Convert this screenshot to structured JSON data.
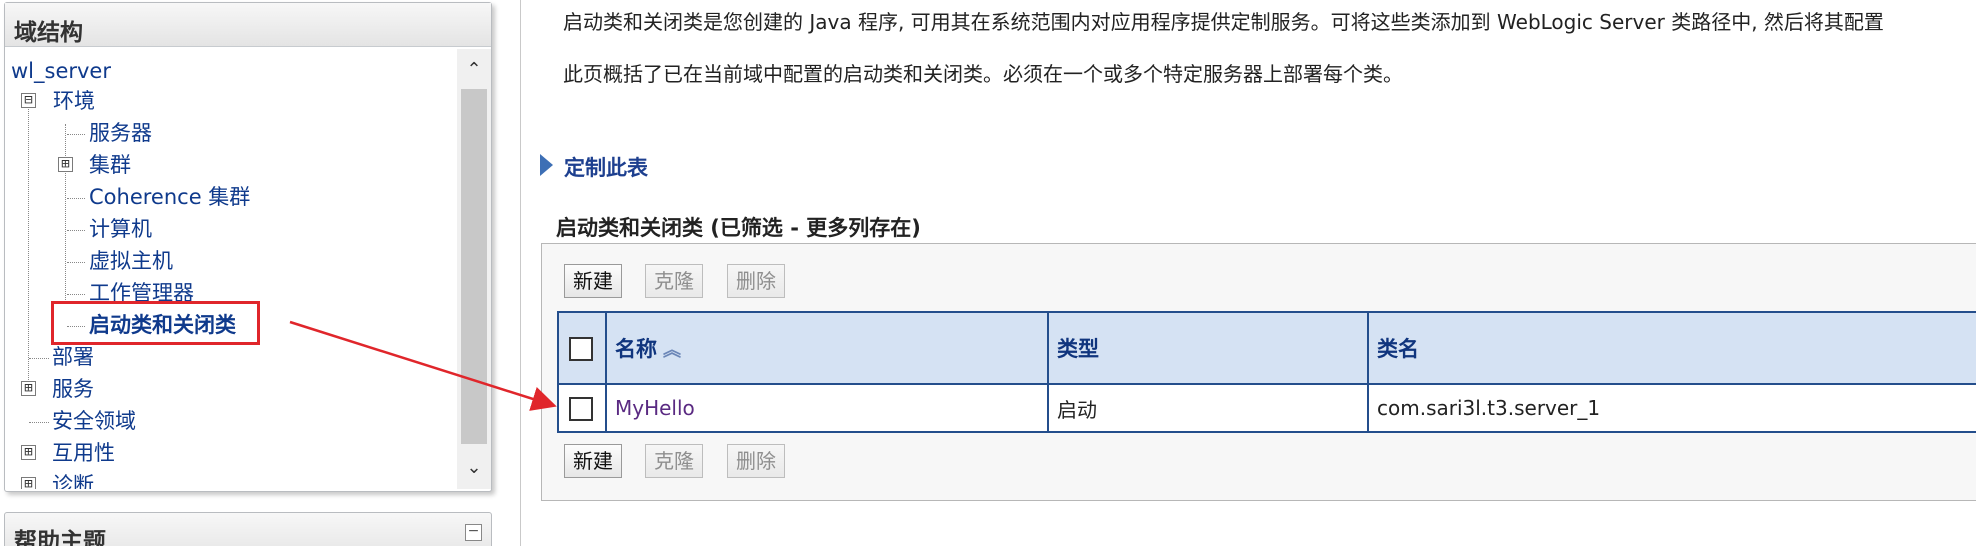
{
  "tree_panel": {
    "title": "域结构",
    "items": [
      {
        "label": "wl_server"
      },
      {
        "label": "环境",
        "expander": "⊟"
      },
      {
        "label": "服务器"
      },
      {
        "label": "集群",
        "expander": "⊞"
      },
      {
        "label": "Coherence 集群"
      },
      {
        "label": "计算机"
      },
      {
        "label": "虚拟主机"
      },
      {
        "label": "工作管理器"
      },
      {
        "label": "启动类和关闭类"
      },
      {
        "label": "部署"
      },
      {
        "label": "服务",
        "expander": "⊞"
      },
      {
        "label": "安全领域"
      },
      {
        "label": "互用性",
        "expander": "⊞"
      },
      {
        "label": "诊断",
        "expander": "⊞"
      }
    ]
  },
  "help_panel": {
    "title": "帮助主题",
    "collapse": "−"
  },
  "content": {
    "intro_line1": "启动类和关闭类是您创建的 Java 程序, 可用其在系统范围内对应用程序提供定制服务。可将这些类添加到 WebLogic Server 类路径中, 然后将其配置",
    "intro_line2": "此页概括了已在当前域中配置的启动类和关闭类。必须在一个或多个特定服务器上部署每个类。",
    "customize_label": "定制此表",
    "section_title": "启动类和关闭类 (已筛选 - 更多列存在)",
    "buttons": {
      "new": "新建",
      "clone": "克隆",
      "delete": "删除"
    },
    "table": {
      "columns": [
        "名称",
        "类型",
        "类名"
      ],
      "rows": [
        {
          "name": "MyHello",
          "type": "启动",
          "class": "com.sari3l.t3.server_1"
        }
      ]
    }
  },
  "colors": {
    "highlight": "#e0262b",
    "header_bg": "#d5e2f3",
    "link": "#0f3a8c"
  }
}
